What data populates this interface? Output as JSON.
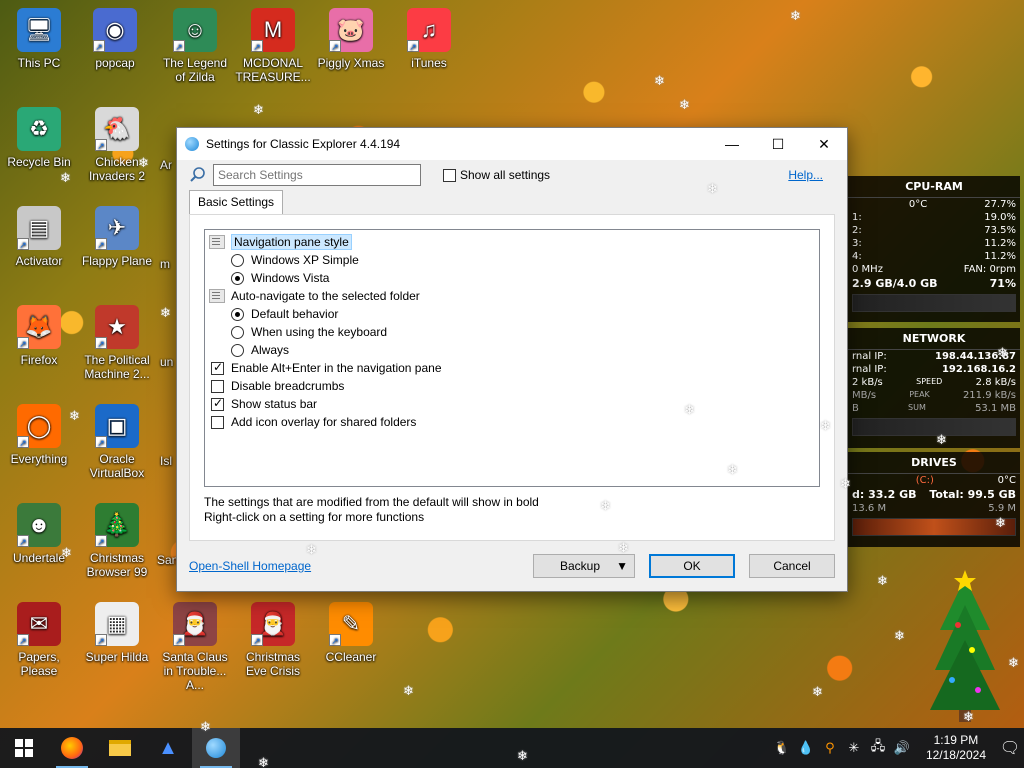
{
  "desktop": {
    "icons": [
      {
        "label": "This PC",
        "icon": "pc-icon",
        "glyph": "🖥"
      },
      {
        "label": "popcap",
        "icon": "popcap-icon",
        "glyph": "◉"
      },
      {
        "label": "The Legend of Zilda",
        "icon": "zilda-icon",
        "glyph": "☺"
      },
      {
        "label": "MCDONAL TREASURE...",
        "icon": "mcdonald-icon",
        "glyph": "M"
      },
      {
        "label": "Piggly Xmas",
        "icon": "pig-icon",
        "glyph": "🐷"
      },
      {
        "label": "iTunes",
        "icon": "itunes-icon",
        "glyph": "♫"
      },
      {
        "label": "Recycle Bin",
        "icon": "recycle-bin-icon",
        "glyph": "♻"
      },
      {
        "label": "Chicken Invaders 2",
        "icon": "chicken-icon",
        "glyph": "🐔"
      },
      {
        "label": "Activator",
        "icon": "activator-icon",
        "glyph": "▤"
      },
      {
        "label": "Flappy Plane",
        "icon": "plane-icon",
        "glyph": "✈"
      },
      {
        "label": "Firefox",
        "icon": "firefox-icon",
        "glyph": "🦊"
      },
      {
        "label": "The Political Machine 2...",
        "icon": "political-icon",
        "glyph": "★"
      },
      {
        "label": "Everything",
        "icon": "everything-icon",
        "glyph": "◯"
      },
      {
        "label": "Oracle VirtualBox",
        "icon": "virtualbox-icon",
        "glyph": "▣"
      },
      {
        "label": "Undertale",
        "icon": "undertale-icon",
        "glyph": "☻"
      },
      {
        "label": "Christmas Browser 99",
        "icon": "xmas-browser-icon",
        "glyph": "🎄"
      },
      {
        "label": "Papers, Please",
        "icon": "papers-icon",
        "glyph": "✉"
      },
      {
        "label": "Super Hilda",
        "icon": "hilda-icon",
        "glyph": "▦"
      },
      {
        "label": "Santa Claus in Trouble... A...",
        "icon": "santa-trouble-icon",
        "glyph": "🎅"
      },
      {
        "label": "Christmas Eve Crisis",
        "icon": "xmas-eve-icon",
        "glyph": "🎅"
      },
      {
        "label": "CCleaner",
        "icon": "ccleaner-icon",
        "glyph": "✎"
      }
    ],
    "partial_labels": {
      "ar": "Ar",
      "m": "m",
      "un": "un",
      "isl": "Isl",
      "san": "San"
    }
  },
  "widgets": {
    "cpu": {
      "title": "CPU-RAM",
      "temp": "0°C",
      "total": "27.7%",
      "cores": [
        {
          "label": "1:",
          "value": "19.0%"
        },
        {
          "label": "2:",
          "value": "73.5%"
        },
        {
          "label": "3:",
          "value": "11.2%"
        },
        {
          "label": "4:",
          "value": "11.2%"
        }
      ],
      "freq": "0 MHz",
      "fan": "FAN: 0rpm",
      "ram": "2.9 GB/4.0 GB",
      "ram_pct": "71%"
    },
    "network": {
      "title": "NETWORK",
      "ext_label": "rnal IP:",
      "ext_ip": "198.44.136.87",
      "int_label": "rnal IP:",
      "int_ip": "192.168.16.2",
      "speed_left": "2 kB/s",
      "speed_label": "SPEED",
      "speed_right": "2.8 kB/s",
      "peak_left": "MB/s",
      "peak_label": "PEAK",
      "peak_right": "211.9 kB/s",
      "sum_left": "B",
      "sum_label": "SUM",
      "sum_right": "53.1 MB"
    },
    "drives": {
      "title": "DRIVES",
      "drive": "(C:)",
      "temp": "0°C",
      "used": "d: 33.2 GB",
      "total": "Total: 99.5 GB",
      "read": "13.6 M",
      "write": "5.9 M"
    }
  },
  "dialog": {
    "title": "Settings for Classic Explorer 4.4.194",
    "search_placeholder": "Search Settings",
    "show_all_label": "Show all settings",
    "help_label": "Help...",
    "tab_label": "Basic Settings",
    "settings": [
      {
        "label": "Navigation pane style",
        "type": "group",
        "level": 0,
        "highlight": true
      },
      {
        "label": "Windows XP Simple",
        "type": "radio",
        "level": 1,
        "checked": false
      },
      {
        "label": "Windows Vista",
        "type": "radio",
        "level": 1,
        "checked": true
      },
      {
        "label": "Auto-navigate to the selected folder",
        "type": "group",
        "level": 0
      },
      {
        "label": "Default behavior",
        "type": "radio",
        "level": 1,
        "checked": true
      },
      {
        "label": "When using the keyboard",
        "type": "radio",
        "level": 1,
        "checked": false
      },
      {
        "label": "Always",
        "type": "radio",
        "level": 1,
        "checked": false
      },
      {
        "label": "Enable Alt+Enter in the navigation pane",
        "type": "checkbox",
        "level": 0,
        "checked": true
      },
      {
        "label": "Disable breadcrumbs",
        "type": "checkbox",
        "level": 0,
        "checked": false
      },
      {
        "label": "Show status bar",
        "type": "checkbox",
        "level": 0,
        "checked": true
      },
      {
        "label": "Add icon overlay for shared folders",
        "type": "checkbox",
        "level": 0,
        "checked": false
      }
    ],
    "note1": "The settings that are modified from the default will show in bold",
    "note2": "Right-click on a setting for more functions",
    "homepage_label": "Open-Shell Homepage",
    "backup_label": "Backup",
    "ok_label": "OK",
    "cancel_label": "Cancel"
  },
  "taskbar": {
    "time": "1:19 PM",
    "date": "12/18/2024"
  },
  "colors": {
    "accent": "#0078d7",
    "link": "#0066cc",
    "taskbar": "#12161c"
  }
}
